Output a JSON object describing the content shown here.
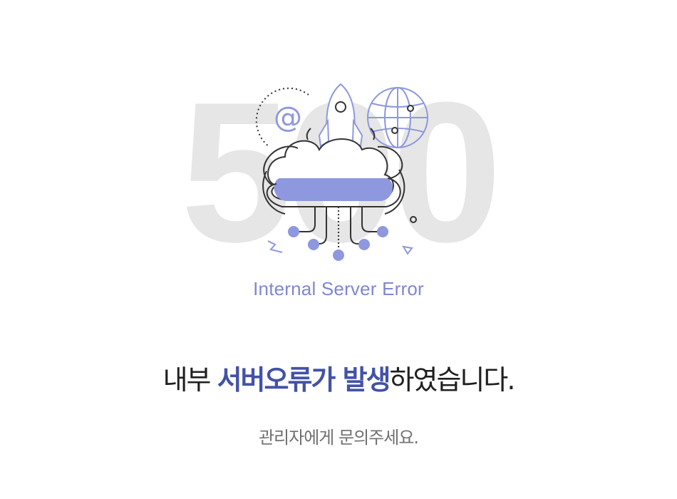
{
  "error": {
    "code": "500",
    "subtitle": "Internal Server Error"
  },
  "message": {
    "part1": "내부 ",
    "part2_bold": "서버오류가 발생",
    "part3": "하였습니다."
  },
  "notice": "관리자에게 문의주세요.",
  "illustration": {
    "at_symbol": "@",
    "icons": [
      "cloud-icon",
      "rocket-icon",
      "globe-icon",
      "email-icon"
    ]
  },
  "colors": {
    "accent": "#8e98de",
    "accent_dark": "#4352a6",
    "outline": "#2a2a2a",
    "background_code": "#e6e6e6"
  }
}
